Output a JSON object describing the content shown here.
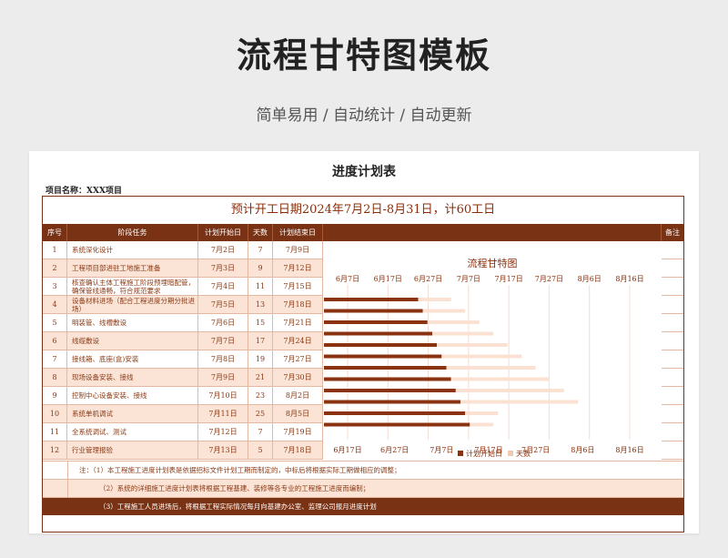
{
  "hero": {
    "title": "流程甘特图模板",
    "subtitle": "简单易用 / 自动统计 / 自动更新"
  },
  "sheet": {
    "title": "进度计划表",
    "project": "项目名称：XXX项目",
    "banner": "预计开工日期2024年7月2日-8月31日，计60工日"
  },
  "table": {
    "headers": [
      "序号",
      "阶段任务",
      "计划开始日",
      "天数",
      "计划结束日",
      "备注"
    ],
    "rows": [
      {
        "no": "1",
        "task": "系统深化设计",
        "start": "7月2日",
        "days": "7",
        "end": "7月9日"
      },
      {
        "no": "2",
        "task": "工程项目部进驻工地施工准备",
        "start": "7月3日",
        "days": "9",
        "end": "7月12日"
      },
      {
        "no": "3",
        "task": "核查确认主体工程施工阶段预埋暗配管，确保管线通畅，符合规范要求",
        "start": "7月4日",
        "days": "11",
        "end": "7月15日"
      },
      {
        "no": "4",
        "task": "设备材料进场（配合工程进度分期分批进场）",
        "start": "7月5日",
        "days": "13",
        "end": "7月18日"
      },
      {
        "no": "5",
        "task": "明装管、线槽敷设",
        "start": "7月6日",
        "days": "15",
        "end": "7月21日"
      },
      {
        "no": "6",
        "task": "线缆敷设",
        "start": "7月7日",
        "days": "17",
        "end": "7月24日"
      },
      {
        "no": "7",
        "task": "接线箱、底座(盒)安装",
        "start": "7月8日",
        "days": "19",
        "end": "7月27日"
      },
      {
        "no": "8",
        "task": "现场设备安装、接线",
        "start": "7月9日",
        "days": "21",
        "end": "7月30日"
      },
      {
        "no": "9",
        "task": "控制中心设备安装、接线",
        "start": "7月10日",
        "days": "23",
        "end": "8月2日"
      },
      {
        "no": "10",
        "task": "系统单机调试",
        "start": "7月11日",
        "days": "25",
        "end": "8月5日"
      },
      {
        "no": "11",
        "task": "全系统调试、测试",
        "start": "7月12日",
        "days": "7",
        "end": "7月19日"
      },
      {
        "no": "12",
        "task": "行业管理报验",
        "start": "7月13日",
        "days": "5",
        "end": "7月18日"
      }
    ]
  },
  "notes": [
    "注：（1）本工程施工进度计划表是依据招标文件计划工期而制定的，中标后将根据实际工期做相应的调整；",
    "（2）系统的详细施工进度计划表将根据工程基建、装修等各专业的工程施工进度而编制；",
    "（3）工程施工人员进场后，将根据工程实际情况每月向基建办公室、监理公司报月进度计划"
  ],
  "chart_data": {
    "type": "bar",
    "orientation": "horizontal-stacked",
    "title": "流程甘特图",
    "top_ticks": [
      "6月7日",
      "6月17日",
      "6月27日",
      "7月7日",
      "7月17日",
      "7月27日",
      "8月6日",
      "8月16日"
    ],
    "bottom_ticks": [
      "6月17日",
      "6月27日",
      "7月7日",
      "7月17日",
      "7月27日",
      "8月6日",
      "8月16日"
    ],
    "xlim": [
      "2024-06-07",
      "2024-08-16"
    ],
    "bottom_xlim": [
      "2024-06-17",
      "2024-08-16"
    ],
    "categories": [
      "1",
      "2",
      "3",
      "4",
      "5",
      "6",
      "7",
      "8",
      "9",
      "10",
      "11",
      "12"
    ],
    "series": [
      {
        "name": "计划开始日",
        "values": [
          "2024-07-02",
          "2024-07-03",
          "2024-07-04",
          "2024-07-05",
          "2024-07-06",
          "2024-07-07",
          "2024-07-08",
          "2024-07-09",
          "2024-07-10",
          "2024-07-11",
          "2024-07-12",
          "2024-07-13"
        ],
        "color": "#8b3310"
      },
      {
        "name": "天数",
        "values": [
          7,
          9,
          11,
          13,
          15,
          17,
          19,
          21,
          23,
          25,
          7,
          5
        ],
        "color": "#fbe1d2"
      }
    ],
    "legend": "bottom-right",
    "grid": true
  }
}
